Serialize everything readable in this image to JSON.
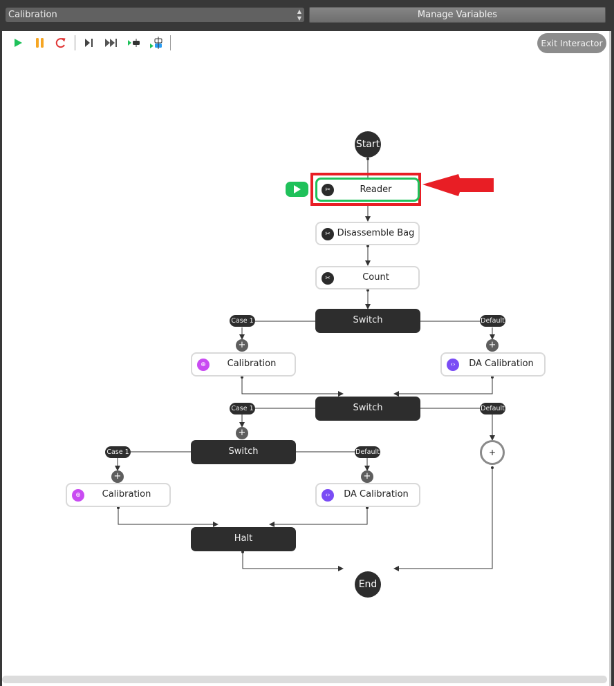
{
  "topbar": {
    "workflow_select": {
      "value": "Calibration"
    },
    "manage_variables_label": "Manage Variables"
  },
  "toolbar": {
    "buttons": [
      {
        "name": "run",
        "icon": "play-icon",
        "color": "#1fc15a"
      },
      {
        "name": "pause",
        "icon": "pause-icon",
        "color": "#f6a623"
      },
      {
        "name": "restart",
        "icon": "restart-icon",
        "color": "#e03434"
      },
      {
        "name": "step",
        "icon": "step-forward-icon",
        "color": "#444444"
      },
      {
        "name": "fast-forward",
        "icon": "fast-forward-icon",
        "color": "#444444"
      },
      {
        "name": "run-to-breakpoint",
        "icon": "run-to-node-icon",
        "color": "#1fc15a"
      },
      {
        "name": "run-to-selected",
        "icon": "run-to-selected-icon",
        "color": "#2a9df4"
      }
    ],
    "exit_label": "Exit Interactor"
  },
  "flow": {
    "start": "Start",
    "end": "End",
    "nodes": {
      "reader": {
        "label": "Reader",
        "icon": "wrench-icon",
        "state": "current"
      },
      "disassemble": {
        "label": "Disassemble Bag",
        "icon": "wrench-icon"
      },
      "count": {
        "label": "Count",
        "icon": "wrench-icon"
      },
      "switch1": {
        "label": "Switch"
      },
      "calib1": {
        "label": "Calibration",
        "icon": "target-icon"
      },
      "dacalib1": {
        "label": "DA Calibration",
        "icon": "code-icon"
      },
      "switch2": {
        "label": "Switch"
      },
      "switch3": {
        "label": "Switch"
      },
      "calib2": {
        "label": "Calibration",
        "icon": "target-icon"
      },
      "dacalib2": {
        "label": "DA Calibration",
        "icon": "code-icon"
      },
      "halt": {
        "label": "Halt"
      }
    },
    "branch_labels": {
      "case1": "Case 1",
      "default": "Default"
    },
    "add_symbol": "+"
  },
  "annotation": {
    "highlight_color": "#e81e25",
    "current_color": "#1fc15a"
  }
}
